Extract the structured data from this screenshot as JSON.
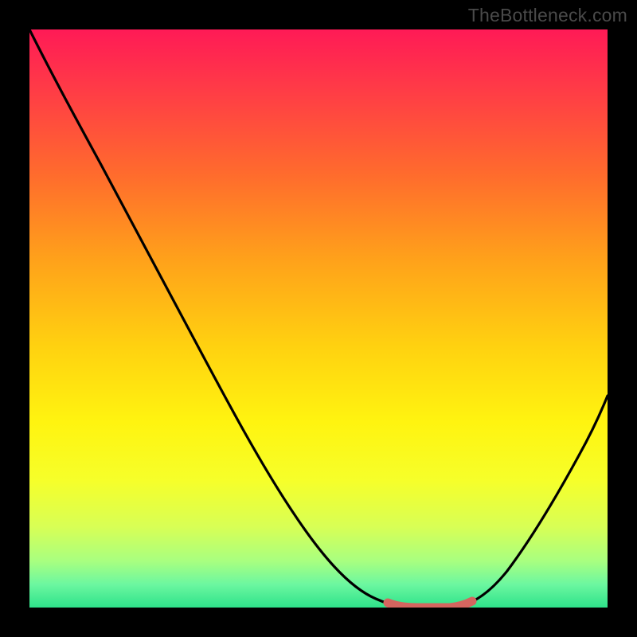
{
  "watermark": "TheBottleneck.com",
  "chart_data": {
    "type": "line",
    "title": "",
    "xlabel": "",
    "ylabel": "",
    "xlim": [
      0,
      100
    ],
    "ylim": [
      0,
      100
    ],
    "grid": false,
    "legend": false,
    "note": "No axis tick labels or numeric data labels are rendered in the image; data points are estimated from the curve shape on a 0–100 normalized scale where y=0 is the top and y=100 is the bottom of the gradient region.",
    "series": [
      {
        "name": "bottleneck-curve",
        "x": [
          0,
          4,
          8,
          12,
          16,
          20,
          24,
          28,
          32,
          36,
          40,
          44,
          48,
          52,
          56,
          60,
          63,
          66,
          70,
          74,
          78,
          82,
          86,
          90,
          94,
          100
        ],
        "y": [
          0,
          8,
          15,
          22,
          29,
          36,
          43,
          50,
          57,
          63,
          70,
          76,
          82,
          88,
          93,
          97,
          99,
          100,
          100,
          99,
          95,
          89,
          82,
          74,
          66,
          53
        ],
        "color": "#000000"
      },
      {
        "name": "highlight-segment",
        "x": [
          63,
          66,
          70,
          74
        ],
        "y": [
          99,
          100,
          100,
          99
        ],
        "color": "#d4655f"
      }
    ],
    "background_gradient_stops": [
      {
        "offset": 0.0,
        "color": "#ff1a56"
      },
      {
        "offset": 0.1,
        "color": "#ff3a47"
      },
      {
        "offset": 0.25,
        "color": "#ff6b2d"
      },
      {
        "offset": 0.4,
        "color": "#ffa21a"
      },
      {
        "offset": 0.55,
        "color": "#ffd210"
      },
      {
        "offset": 0.68,
        "color": "#fff410"
      },
      {
        "offset": 0.78,
        "color": "#f6ff2a"
      },
      {
        "offset": 0.86,
        "color": "#d8ff55"
      },
      {
        "offset": 0.92,
        "color": "#a8ff80"
      },
      {
        "offset": 0.96,
        "color": "#6cf7a0"
      },
      {
        "offset": 1.0,
        "color": "#2ee28a"
      }
    ]
  }
}
